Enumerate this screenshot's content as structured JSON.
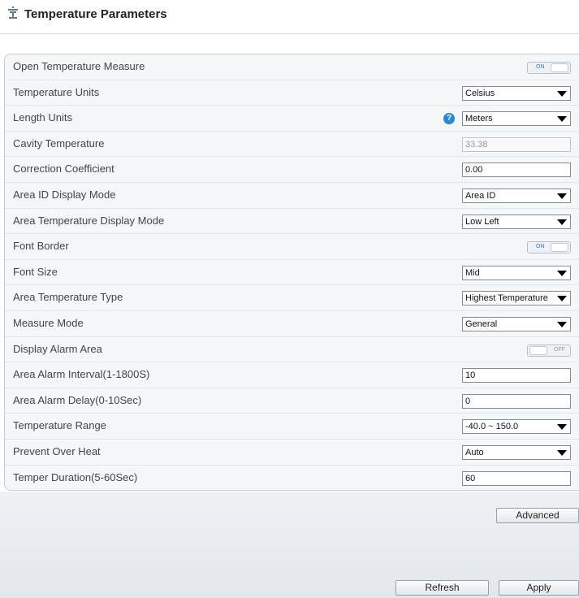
{
  "header": {
    "title": "Temperature Parameters",
    "icon": "thermometer-icon"
  },
  "rows": [
    {
      "label": "Open Temperature Measure",
      "control": "toggle",
      "state": "on",
      "text": "ON"
    },
    {
      "label": "Temperature Units",
      "control": "select",
      "value": "Celsius"
    },
    {
      "label": "Length Units",
      "control": "select",
      "value": "Meters",
      "help": "?"
    },
    {
      "label": "Cavity Temperature",
      "control": "text-disabled",
      "value": "33.38"
    },
    {
      "label": "Correction Coefficient",
      "control": "text",
      "value": "0.00"
    },
    {
      "label": "Area ID Display Mode",
      "control": "select",
      "value": "Area ID"
    },
    {
      "label": "Area Temperature Display Mode",
      "control": "select",
      "value": "Low Left"
    },
    {
      "label": "Font Border",
      "control": "toggle",
      "state": "on",
      "text": "ON"
    },
    {
      "label": "Font Size",
      "control": "select",
      "value": "Mid"
    },
    {
      "label": "Area Temperature Type",
      "control": "select",
      "value": "Highest Temperature"
    },
    {
      "label": "Measure Mode",
      "control": "select",
      "value": "General"
    },
    {
      "label": "Display Alarm Area",
      "control": "toggle",
      "state": "off",
      "text": "OFF"
    },
    {
      "label": "Area Alarm Interval(1-1800S)",
      "control": "text",
      "value": "10"
    },
    {
      "label": "Area Alarm Delay(0-10Sec)",
      "control": "text",
      "value": "0"
    },
    {
      "label": "Temperature Range",
      "control": "select",
      "value": "-40.0 ~ 150.0"
    },
    {
      "label": "Prevent Over Heat",
      "control": "select",
      "value": "Auto"
    },
    {
      "label": "Temper Duration(5-60Sec)",
      "control": "text",
      "value": "60"
    }
  ],
  "buttons": {
    "advanced": "Advanced",
    "refresh": "Refresh",
    "apply": "Apply"
  },
  "colors": {
    "accent": "#2a86d6",
    "toggle_text": "#3e76c4"
  }
}
